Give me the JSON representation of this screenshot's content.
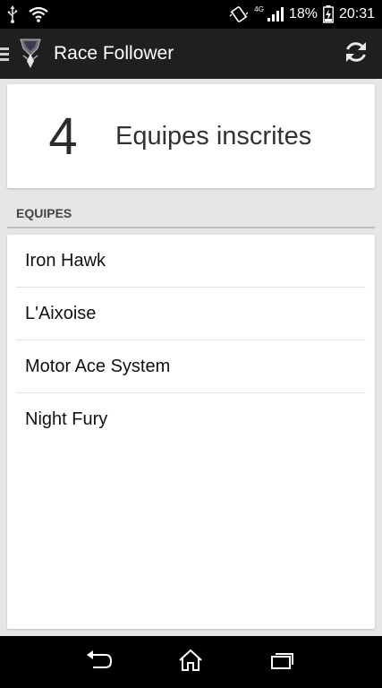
{
  "status_bar": {
    "battery_percent": "18%",
    "time": "20:31",
    "network": "4G",
    "icons": [
      "usb-icon",
      "wifi-icon",
      "vibrate-icon",
      "signal-icon",
      "battery-charging-icon"
    ]
  },
  "action_bar": {
    "title": "Race Follower",
    "icons": [
      "drawer-icon",
      "app-logo-icon",
      "refresh-icon"
    ]
  },
  "summary": {
    "count": "4",
    "label": "Equipes inscrites"
  },
  "section": {
    "title": "EQUIPES"
  },
  "teams": [
    {
      "name": "Iron Hawk"
    },
    {
      "name": "L'Aixoise"
    },
    {
      "name": "Motor Ace System"
    },
    {
      "name": "Night Fury"
    }
  ],
  "nav_bar": {
    "icons": [
      "back-icon",
      "home-icon",
      "recent-apps-icon"
    ]
  },
  "colors": {
    "status_bar": "#000000",
    "action_bar": "#1f1f1f",
    "background": "#e6e6e6",
    "card": "#ffffff"
  }
}
